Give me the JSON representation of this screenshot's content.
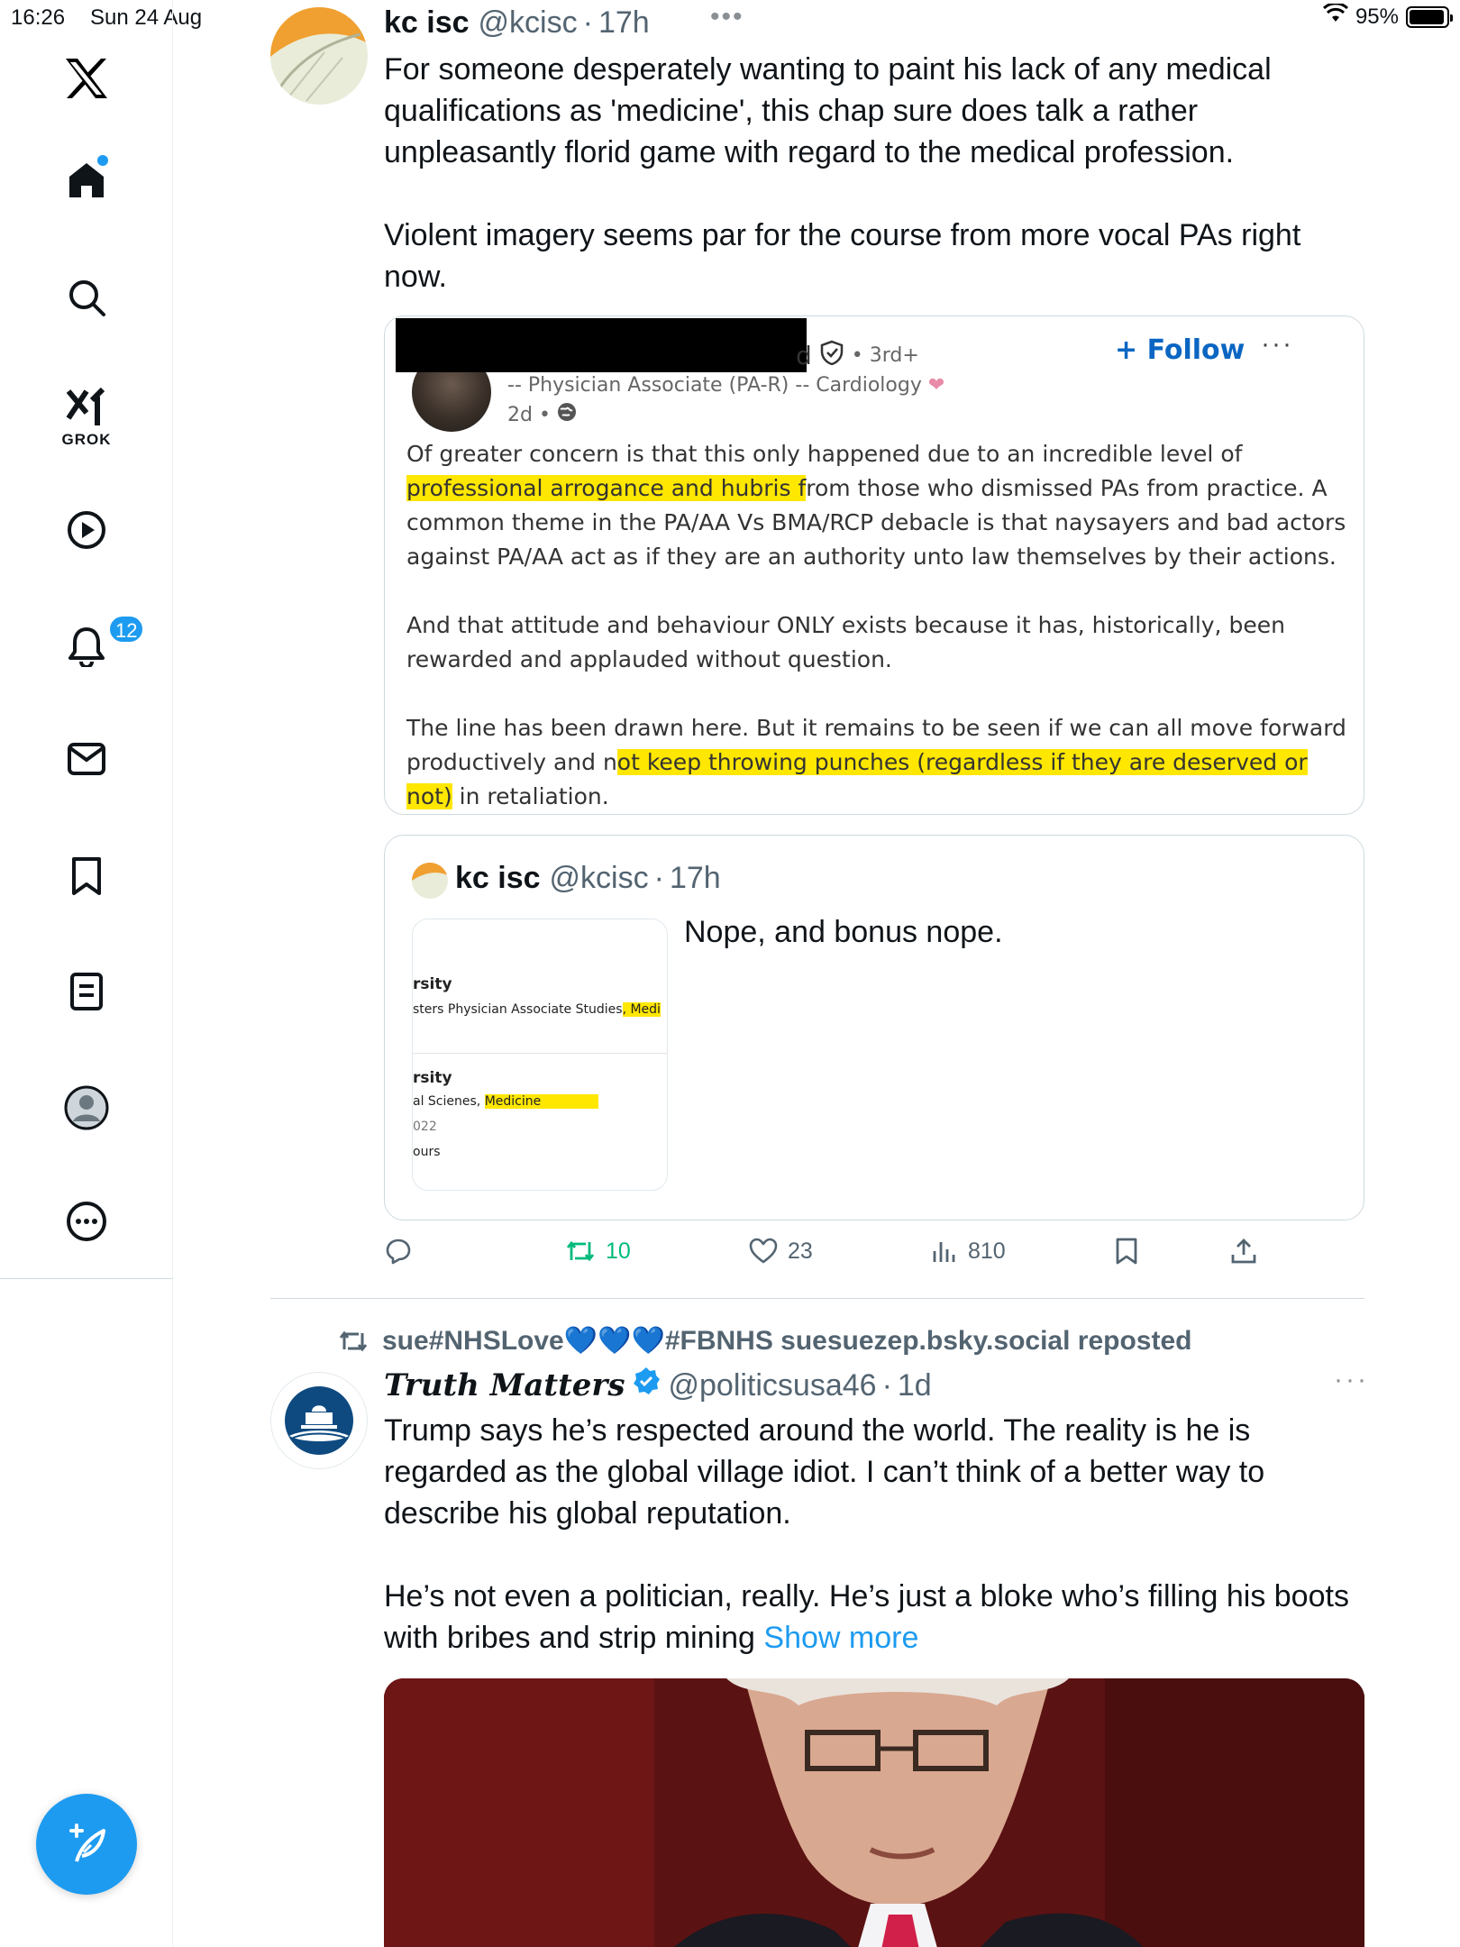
{
  "status_bar": {
    "time": "16:26",
    "date": "Sun 24 Aug",
    "battery": "95%",
    "battery_level": 0.95
  },
  "sidebar": {
    "items": [
      {
        "name": "x-logo",
        "label": ""
      },
      {
        "name": "home",
        "label": ""
      },
      {
        "name": "explore",
        "label": ""
      },
      {
        "name": "grok",
        "label": "GROK"
      },
      {
        "name": "video",
        "label": ""
      },
      {
        "name": "notifications",
        "label": "",
        "badge": "12"
      },
      {
        "name": "messages",
        "label": ""
      },
      {
        "name": "bookmarks",
        "label": ""
      },
      {
        "name": "lists",
        "label": ""
      },
      {
        "name": "profile",
        "label": ""
      },
      {
        "name": "more",
        "label": ""
      }
    ],
    "notification_badge": "12",
    "grok_label": "GROK"
  },
  "tweet1": {
    "name": "kc isc",
    "handle": "@kcisc",
    "time": "17h",
    "paragraphs": [
      "For someone desperately wanting to paint his lack of any medical qualifications as 'medicine', this chap sure does talk a rather unpleasantly florid game with regard to the medical profession.",
      "Violent imagery seems par for the course from more vocal PAs right now."
    ],
    "embedded_post": {
      "name_tail": "d",
      "degree": "• 3rd+",
      "headline": "-- Physician Associate (PA-R) -- Cardiology",
      "time": "2d •",
      "follow_label": "+ Follow",
      "more": "···",
      "p1_a": "Of greater concern is that this only happened due to an incredible level of ",
      "p1_hl": "professional arrogance and hubris f",
      "p1_b": "rom those who dismissed PAs from practice. A common theme in the PA/AA Vs BMA/RCP debacle is that naysayers and bad actors against PA/AA act as if they are an authority unto law themselves by their actions.",
      "p2": "And that attitude and behaviour ONLY exists because it has, historically, been rewarded and applauded without question.",
      "p3_a": "The line has been drawn here. But it remains to be seen if we can all move forward productively and n",
      "p3_hl": "ot keep throwing punches (regardless if they are deserved or not)",
      "p3_b": " in retaliation."
    },
    "quoted": {
      "name": "kc isc",
      "handle": "@kcisc",
      "time": "17h",
      "text": "Nope, and bonus nope.",
      "media": {
        "entry1_title": "rsity",
        "entry1_line": "sters Physician Associate Studies",
        "entry1_hl": ", Medi",
        "entry2_title": "rsity",
        "entry2_line": "al Scienes, ",
        "entry2_hl": "Medicine",
        "entry2_year": "022",
        "entry2_extra": "ours"
      }
    },
    "actions": {
      "replies": "",
      "reposts": "10",
      "likes": "23",
      "views": "810"
    }
  },
  "tweet2": {
    "reposted_by": "sue#NHSLove",
    "reposted_hearts": "💙💙💙",
    "reposted_suffix": "#FBNHS suesuezep.bsky.social reposted",
    "name": "Truth Matters",
    "handle": "@politicsusa46",
    "time": "1d",
    "paragraphs": [
      "Trump says he’s respected around the world. The reality is he is regarded as the global village idiot. I can’t think of a better way to describe his global reputation.",
      "He’s not even a politician, really. He’s just a bloke who’s filling his boots with bribes and strip mining"
    ],
    "show_more": "Show more"
  },
  "colors": {
    "accent": "#1d9bf0",
    "repost_green": "#00ba7c",
    "highlight": "#ffe700",
    "linkedin_blue": "#0a66c2"
  }
}
